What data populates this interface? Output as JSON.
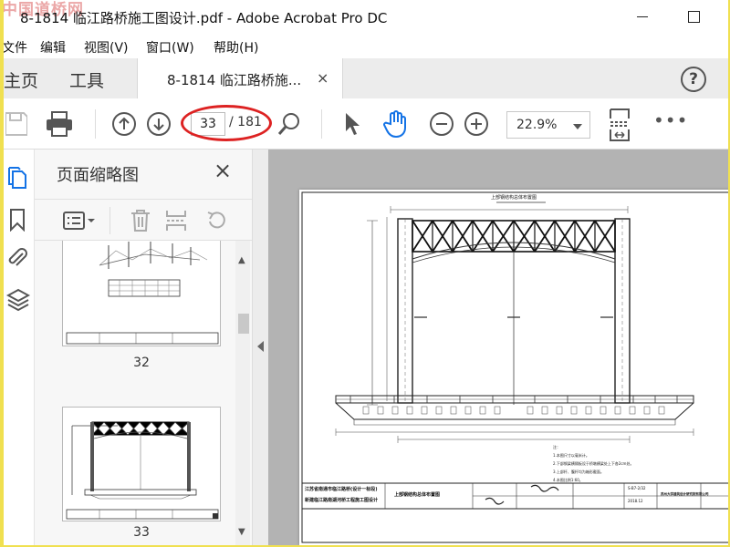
{
  "window": {
    "title": "8-1814 临江路桥施工图设计.pdf - Adobe Acrobat Pro DC",
    "watermark": "中国道桥网"
  },
  "menu": [
    "文件",
    "编辑",
    "视图(V)",
    "窗口(W)",
    "帮助(H)"
  ],
  "tabs": {
    "home": "主页",
    "tools": "工具",
    "document": "8-1814 临江路桥施...",
    "close": "×",
    "help": "?"
  },
  "toolbar": {
    "current_page": "33",
    "page_total": "/ 181",
    "zoom": "22.9%",
    "more": "•••"
  },
  "panel": {
    "title": "页面缩略图",
    "close": "×",
    "thumbnails": [
      {
        "label": "32"
      },
      {
        "label": "33"
      }
    ]
  },
  "drawing": {
    "title": "上部钢结构总体布置图",
    "title_block_left_1": "江苏省南通市临江路桥(设计一标段)",
    "title_block_left_2": "新建临江路南湖河桥工程施工图设计",
    "title_block_center": "上部钢结构总体布置图",
    "design_unit": "苏州大学建筑设计研究院有限公司",
    "drawing_no": "S-B7-2/32",
    "date": "2018.12",
    "notes_header": "注：",
    "notes": [
      "1.本图尺寸以毫米计。",
      "2.下部钢梁横隔板设于桥墩横梁处上下各2cm处。",
      "3.上部杆、腹杆均为箱形截面。",
      "4.本图比例1:60。"
    ]
  },
  "colors": {
    "accent_blue": "#1473e6",
    "highlight_red": "#dd2222",
    "canvas_gray": "#b3b3b3"
  }
}
